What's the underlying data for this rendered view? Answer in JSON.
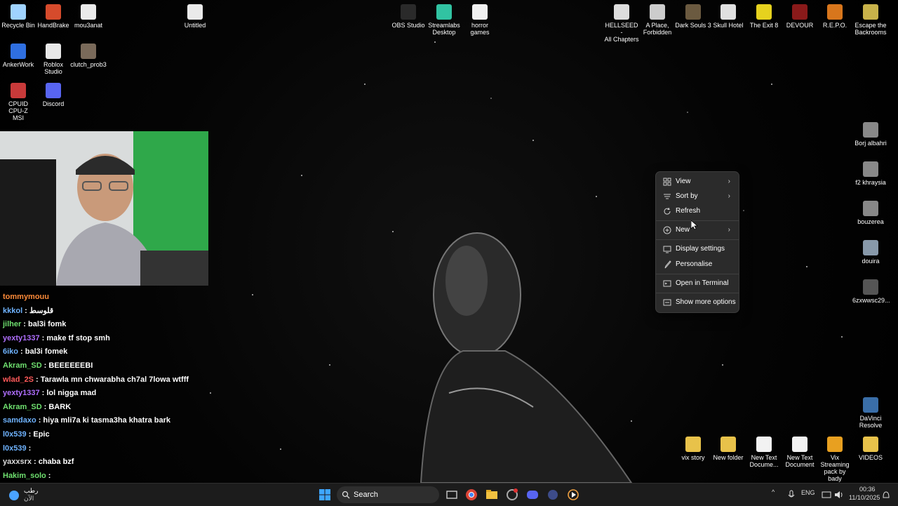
{
  "desktop_icons": [
    {
      "label": "Recycle Bin",
      "icon": "recycle-bin-icon",
      "color": "#9fd3ff"
    },
    {
      "label": "HandBrake",
      "icon": "handbrake-icon",
      "color": "#d64b2c"
    },
    {
      "label": "mou3anat",
      "icon": "file-icon",
      "color": "#eaeaea"
    },
    {
      "label": "Untitled",
      "icon": "file-icon",
      "color": "#eaeaea"
    },
    {
      "label": "AnkerWork",
      "icon": "ankerwork-icon",
      "color": "#2f6fe0"
    },
    {
      "label": "Roblox\nStudio",
      "icon": "roblox-studio-icon",
      "color": "#e8e8e8"
    },
    {
      "label": "clutch_prob3",
      "icon": "file-icon",
      "color": "#7a6a5a"
    },
    {
      "label": "CPUID CPU-Z\nMSI",
      "icon": "cpuz-icon",
      "color": "#c83a3a"
    },
    {
      "label": "Discord",
      "icon": "discord-icon",
      "color": "#5865f2"
    },
    {
      "label": "OBS Studio",
      "icon": "obs-icon",
      "color": "#2a2a2a"
    },
    {
      "label": "Streamlabs\nDesktop",
      "icon": "streamlabs-icon",
      "color": "#31c3a2"
    },
    {
      "label": "horror games",
      "icon": "document-icon",
      "color": "#f0f0f0"
    },
    {
      "label": "HELLSEED -\nAll Chapters",
      "icon": "hellseed-icon",
      "color": "#dddddd"
    },
    {
      "label": "A Place,\nForbidden",
      "icon": "game-icon",
      "color": "#cccccc"
    },
    {
      "label": "Dark Souls 3",
      "icon": "dark-souls-icon",
      "color": "#6b5a40"
    },
    {
      "label": "Skull Hotel",
      "icon": "skull-hotel-icon",
      "color": "#e0e0e0"
    },
    {
      "label": "The Exit 8",
      "icon": "exit8-icon",
      "color": "#e6d21e"
    },
    {
      "label": "DEVOUR",
      "icon": "devour-icon",
      "color": "#8a1a1a"
    },
    {
      "label": "R.E.P.O.",
      "icon": "repo-icon",
      "color": "#d8761c"
    },
    {
      "label": "Escape the\nBackrooms",
      "icon": "backrooms-icon",
      "color": "#c8b24a"
    },
    {
      "label": "Borj albahri",
      "icon": "image-file-icon",
      "color": "#888888"
    },
    {
      "label": "f2 khraysia",
      "icon": "image-file-icon",
      "color": "#888888"
    },
    {
      "label": "bouzerea",
      "icon": "image-file-icon",
      "color": "#888888"
    },
    {
      "label": "douira",
      "icon": "image-file-icon",
      "color": "#8899aa"
    },
    {
      "label": "6zxwwsc29...",
      "icon": "image-file-icon",
      "color": "#555555"
    },
    {
      "label": "DaVinci\nResolve",
      "icon": "davinci-icon",
      "color": "#3a6ea8"
    },
    {
      "label": "vix story",
      "icon": "folder-icon",
      "color": "#e8c24a"
    },
    {
      "label": "New folder",
      "icon": "folder-icon",
      "color": "#e8c24a"
    },
    {
      "label": "New Text\nDocume...",
      "icon": "text-document-icon",
      "color": "#f2f2f2"
    },
    {
      "label": "New Text\nDocument",
      "icon": "text-document-icon",
      "color": "#f2f2f2"
    },
    {
      "label": "Vix Streaming\npack by bady",
      "icon": "folder-icon",
      "color": "#e8a020"
    },
    {
      "label": "VIDEOS",
      "icon": "folder-icon",
      "color": "#e8c24a"
    }
  ],
  "chat": [
    {
      "user": "tommymouu",
      "msg": "",
      "color": "#ff8c3a"
    },
    {
      "user": "kkkol",
      "msg": ": قلوسط",
      "color": "#6fb3ff"
    },
    {
      "user": "jilher",
      "msg": ": bal3i fomk",
      "color": "#6fe06f"
    },
    {
      "user": "yexty1337",
      "msg": ": make tf stop smh",
      "color": "#b06fff"
    },
    {
      "user": "6iko",
      "msg": ": bal3i fomek",
      "color": "#6fb3ff"
    },
    {
      "user": "Akram_SD",
      "msg": ": BEEEEEEBI",
      "color": "#6fe06f"
    },
    {
      "user": "wlad_2S",
      "msg": ": Tarawla mn chwarabha ch7al 7lowa wtfff",
      "color": "#ff5a5a"
    },
    {
      "user": "yexty1337",
      "msg": ": lol nigga mad",
      "color": "#b06fff"
    },
    {
      "user": "Akram_SD",
      "msg": ": BARK",
      "color": "#6fe06f"
    },
    {
      "user": "samdaxo",
      "msg": ": hiya mli7a ki tasma3ha khatra bark",
      "color": "#6fb3ff"
    },
    {
      "user": "l0x539",
      "msg": ": Epic",
      "color": "#6fb3ff"
    },
    {
      "user": "l0x539",
      "msg": ":",
      "color": "#6fb3ff"
    },
    {
      "user": "yaxxsrx",
      "msg": ": chaba bzf",
      "color": "#dddddd"
    },
    {
      "user": "Hakim_solo",
      "msg": ":",
      "color": "#6fe06f"
    }
  ],
  "context_menu": {
    "items": [
      {
        "label": "View",
        "icon": "view-grid-icon",
        "submenu": true
      },
      {
        "label": "Sort by",
        "icon": "sort-icon",
        "submenu": true
      },
      {
        "label": "Refresh",
        "icon": "refresh-icon",
        "submenu": false
      },
      {
        "label": "New",
        "icon": "new-plus-icon",
        "submenu": true
      },
      {
        "label": "Display settings",
        "icon": "display-icon",
        "submenu": false
      },
      {
        "label": "Personalise",
        "icon": "brush-icon",
        "submenu": false
      },
      {
        "label": "Open in Terminal",
        "icon": "terminal-icon",
        "submenu": false
      },
      {
        "label": "Show more options",
        "icon": "more-options-icon",
        "submenu": false
      }
    ]
  },
  "taskbar": {
    "weather_top": "رطب",
    "weather_bottom": "الآن",
    "search_label": "Search",
    "language": "ENG",
    "time": "00:36",
    "date": "11/10/2025"
  },
  "colors": {
    "menu_bg": "#2b2b2b",
    "taskbar_bg": "#1c1c1c",
    "accent": "#0078d4"
  }
}
